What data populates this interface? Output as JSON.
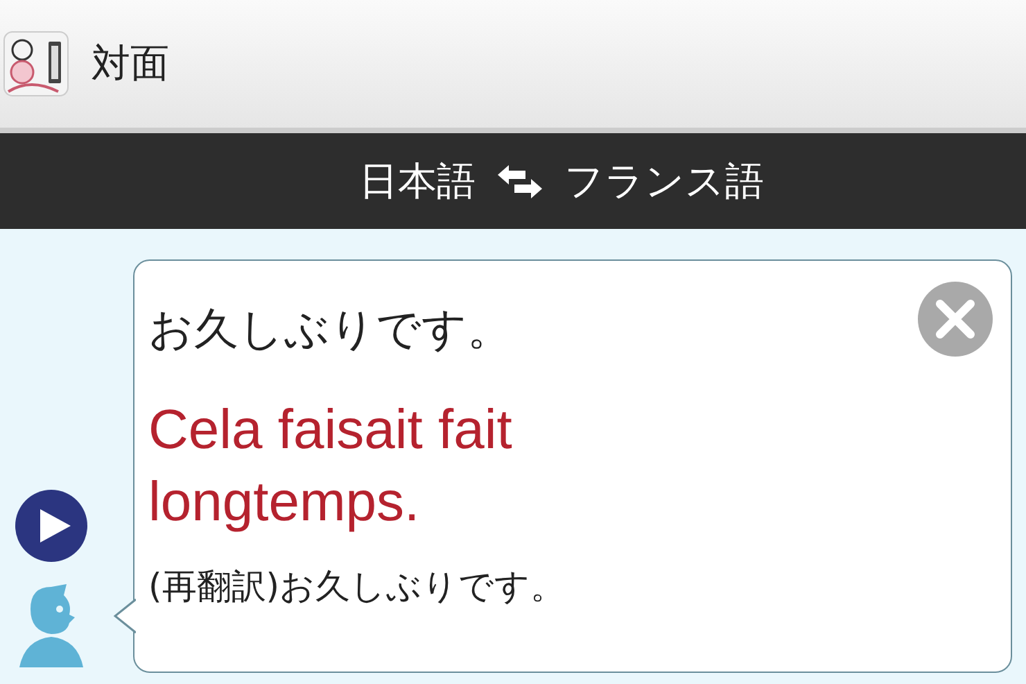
{
  "app_bar": {
    "title": "対面"
  },
  "language_bar": {
    "source": "日本語",
    "target": "フランス語"
  },
  "conversation": {
    "original": "お久しぶりです。",
    "translation": "Cela faisait fait longtemps.",
    "back_translation": "(再翻訳)お久しぶりです。"
  }
}
